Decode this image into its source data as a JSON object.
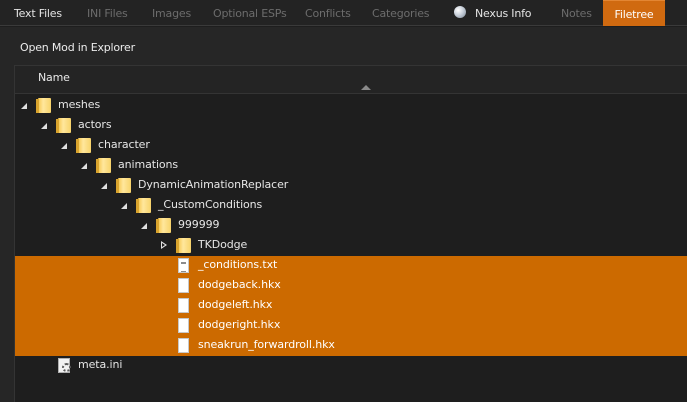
{
  "tabs": [
    {
      "label": "Text Files",
      "enabled": true,
      "active": false
    },
    {
      "label": "INI Files",
      "enabled": false,
      "active": false
    },
    {
      "label": "Images",
      "enabled": false,
      "active": false
    },
    {
      "label": "Optional ESPs",
      "enabled": false,
      "active": false
    },
    {
      "label": "Conflicts",
      "enabled": false,
      "active": false
    },
    {
      "label": "Categories",
      "enabled": false,
      "active": false
    },
    {
      "label": "Nexus Info",
      "enabled": true,
      "active": false,
      "icon": "globe-icon"
    },
    {
      "label": "Notes",
      "enabled": false,
      "active": false
    },
    {
      "label": "Filetree",
      "enabled": true,
      "active": true
    }
  ],
  "toolbar": {
    "open_mod_label": "Open Mod in Explorer"
  },
  "tree": {
    "column_header": "Name",
    "sort": "ascending",
    "rows": [
      {
        "label": "meshes",
        "type": "folder",
        "depth": 0,
        "expander": "open",
        "selected": false
      },
      {
        "label": "actors",
        "type": "folder",
        "depth": 1,
        "expander": "open",
        "selected": false
      },
      {
        "label": "character",
        "type": "folder",
        "depth": 2,
        "expander": "open",
        "selected": false
      },
      {
        "label": "animations",
        "type": "folder",
        "depth": 3,
        "expander": "open",
        "selected": false
      },
      {
        "label": "DynamicAnimationReplacer",
        "type": "folder",
        "depth": 4,
        "expander": "open",
        "selected": false
      },
      {
        "label": "_CustomConditions",
        "type": "folder",
        "depth": 5,
        "expander": "open",
        "selected": false
      },
      {
        "label": "999999",
        "type": "folder",
        "depth": 6,
        "expander": "open",
        "selected": false
      },
      {
        "label": "TKDodge",
        "type": "folder",
        "depth": 7,
        "expander": "closed",
        "selected": false
      },
      {
        "label": "_conditions.txt",
        "type": "text-file",
        "depth": 7,
        "expander": "none",
        "selected": true
      },
      {
        "label": "dodgeback.hkx",
        "type": "file",
        "depth": 7,
        "expander": "none",
        "selected": true
      },
      {
        "label": "dodgeleft.hkx",
        "type": "file",
        "depth": 7,
        "expander": "none",
        "selected": true
      },
      {
        "label": "dodgeright.hkx",
        "type": "file",
        "depth": 7,
        "expander": "none",
        "selected": true
      },
      {
        "label": "sneakrun_forwardroll.hkx",
        "type": "file",
        "depth": 7,
        "expander": "none",
        "selected": true
      },
      {
        "label": "meta.ini",
        "type": "ini-file",
        "depth": 1,
        "expander": "none",
        "selected": false
      }
    ]
  },
  "colors": {
    "accent": "#cc6a00",
    "background": "#1e1e1e"
  }
}
